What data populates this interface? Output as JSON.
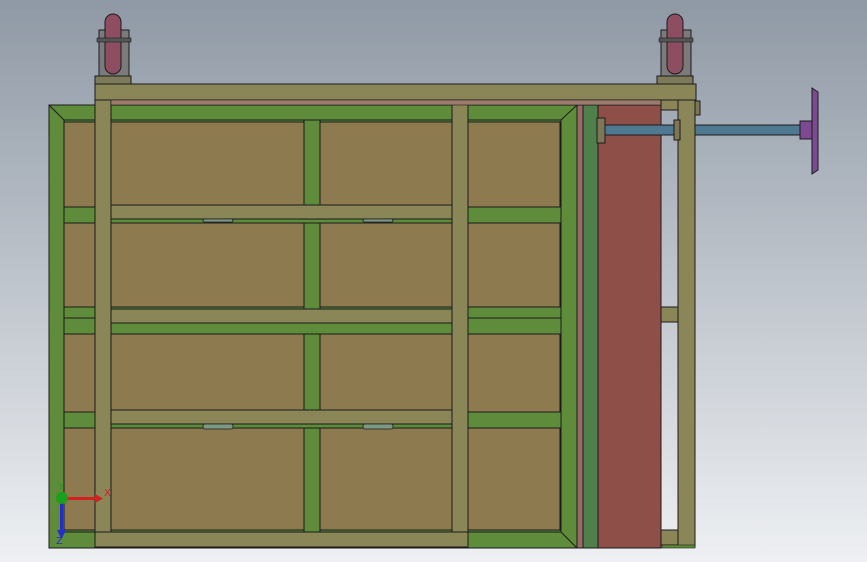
{
  "viewport": {
    "background_top": "#8f99a5",
    "background_bottom": "#eef0f3"
  },
  "colors": {
    "outer_frame": "#5e8c3a",
    "panel": "#8d7a4f",
    "front_frame": "#8b8658",
    "green_plate": "#4f7f4a",
    "red_plate": "#8e4f48",
    "caster_wheel": "#8e4e62",
    "shaft": "#4f7990",
    "handwheel": "#7b4a91",
    "line": "#1b1b1b",
    "axis_x": "#d32020",
    "axis_y": "#1aa01a",
    "axis_z": "#2030c8"
  },
  "triad": {
    "x_label": "X",
    "y_label": "Y",
    "z_label": "Z"
  },
  "icons": {
    "axis_triad": "coordinate-triad-icon"
  }
}
